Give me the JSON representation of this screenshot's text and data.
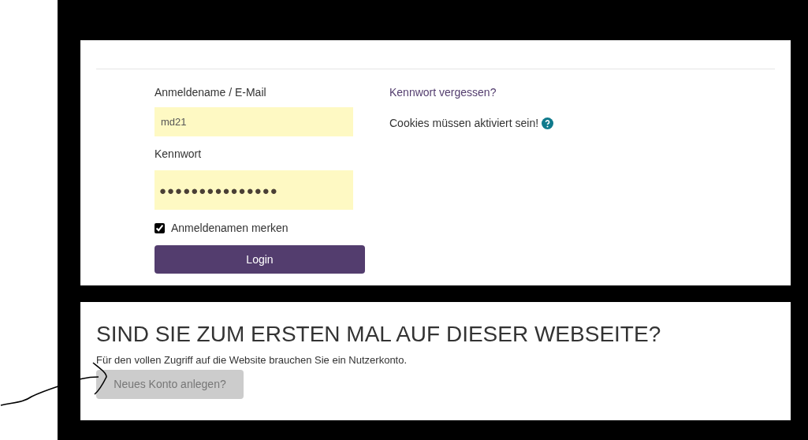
{
  "login": {
    "username_label": "Anmeldename / E-Mail",
    "username_value": "md21",
    "password_label": "Kennwort",
    "password_value": "●●●●●●●●●●●●●●●",
    "remember": {
      "label": "Anmeldenamen merken",
      "checked": true
    },
    "login_button": "Login",
    "forgot_link": "Kennwort vergessen?",
    "cookies_note": "Cookies müssen aktiviert sein!"
  },
  "signup": {
    "heading": "SIND SIE ZUM ERSTEN MAL AUF DIESER WEBSEITE?",
    "text": "Für den vollen Zugriff auf die Website brauchen Sie ein Nutzerkonto.",
    "button": "Neues Konto anlegen?"
  }
}
